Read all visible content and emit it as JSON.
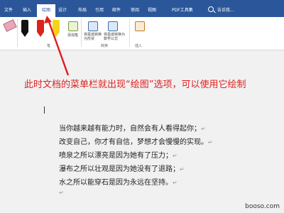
{
  "tabs": [
    {
      "label": "文件"
    },
    {
      "label": "插入"
    },
    {
      "label": "绘图"
    },
    {
      "label": "设计"
    },
    {
      "label": "布局"
    },
    {
      "label": "引用"
    },
    {
      "label": "邮件"
    },
    {
      "label": "审阅"
    },
    {
      "label": "视图"
    },
    {
      "label": "PDF工具集"
    },
    {
      "label": "告诉我..."
    }
  ],
  "ribbon": {
    "convert_btn": "将墨迹转换为形状",
    "convert_btn2": "将墨迹转换为数学公式",
    "add_pen": "添加笔",
    "group_tools": "笔",
    "group_convert": "转换",
    "group_insert": "插入"
  },
  "annotation": "此时文档的菜单栏就出现“绘图”选项，可以使用它绘制",
  "document": {
    "lines": [
      "当你越来越有能力时，自然会有人看得起你；",
      "改变自己，你才有自信，梦想才会慢慢的实现。",
      "喷泉之所以漂亮是因为她有了压力；",
      "瀑布之所以壮观是因为她没有了退路；",
      "水之所以能穿石是因为永远在坚持。"
    ],
    "paragraph_mark": "↵"
  },
  "watermark": "booso.com",
  "colors": {
    "tab_bar": "#2b579a",
    "annotation": "#e02020",
    "pen_black": "#111111",
    "pen_red": "#d9241c",
    "pen_yellow": "#f5d31a"
  }
}
